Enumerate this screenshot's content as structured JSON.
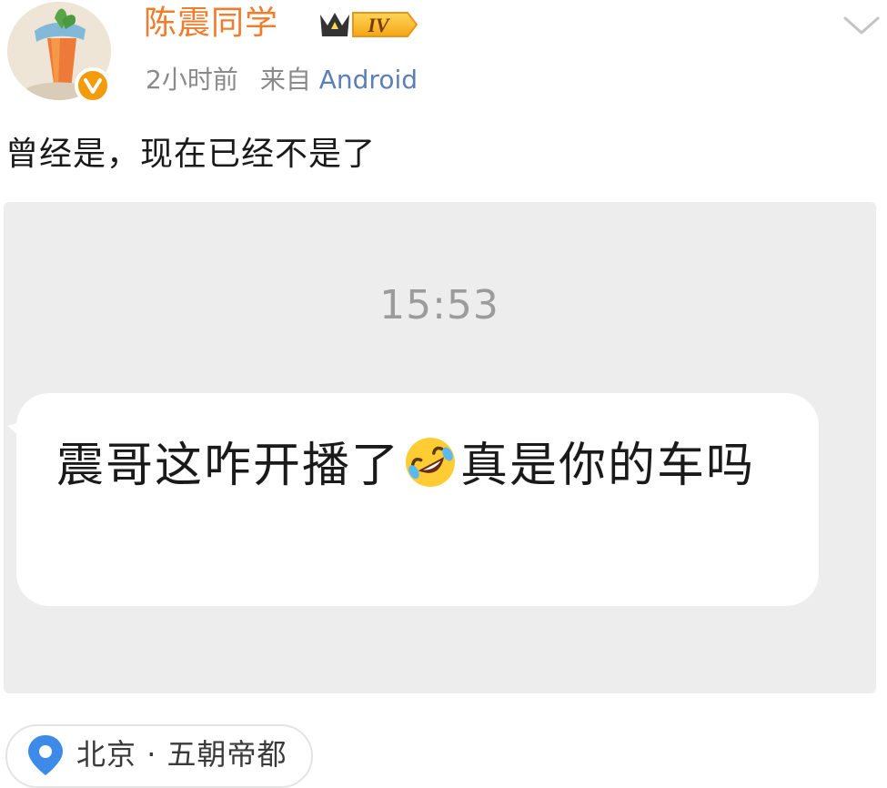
{
  "post": {
    "author": {
      "name": "陈震同学",
      "vip_level": "IV"
    },
    "meta": {
      "time": "2小时前",
      "source_prefix": "来自",
      "source_app": "Android"
    },
    "text": "曾经是，现在已经不是了",
    "attachment": {
      "chat_time": "15:53",
      "message_before_emoji": "震哥这咋开播了",
      "emoji_icon": "rolling-on-floor-laughing-emoji",
      "message_after_emoji": "真是你的车吗"
    },
    "location": {
      "city": "北京",
      "separator": "·",
      "place": "五朝帝都"
    }
  },
  "colors": {
    "username": "#f07c2c",
    "source_link": "#5b7fb6",
    "meta_gray": "#8a8a8a",
    "screenshot_bg": "#ededed",
    "verified_badge": "#f29b0d",
    "location_pin": "#3d8ae8"
  }
}
